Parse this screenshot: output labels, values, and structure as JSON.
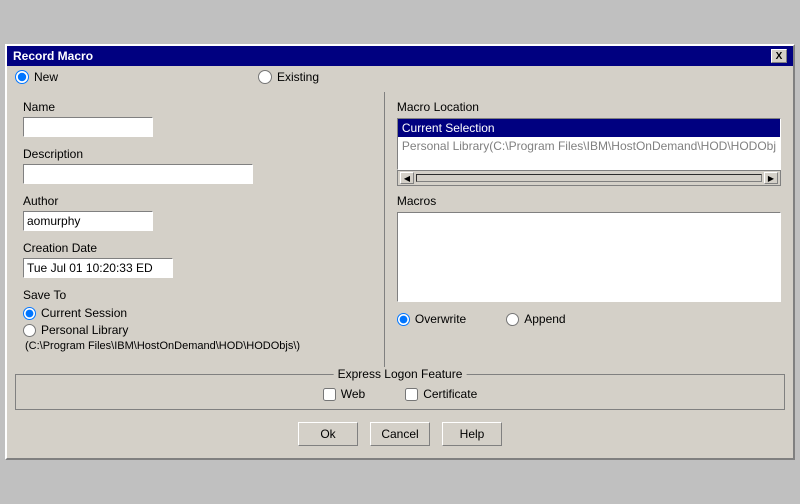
{
  "dialog": {
    "title": "Record Macro",
    "close_label": "X"
  },
  "top": {
    "new_label": "New",
    "existing_label": "Existing"
  },
  "left": {
    "name_label": "Name",
    "name_value": "",
    "name_placeholder": "",
    "description_label": "Description",
    "description_value": "",
    "description_placeholder": "",
    "author_label": "Author",
    "author_value": "aomurphy",
    "date_label": "Creation Date",
    "date_value": "Tue Jul 01 10:20:33 ED",
    "save_to_label": "Save To",
    "current_session_label": "Current Session",
    "personal_library_label": "Personal Library",
    "personal_library_path": "(C:\\Program Files\\IBM\\HostOnDemand\\HOD\\HODObjs\\)"
  },
  "right": {
    "macro_location_label": "Macro Location",
    "location_items": [
      {
        "text": "Current Selection",
        "selected": true
      },
      {
        "text": "Personal Library(C:\\Program Files\\IBM\\HostOnDemand\\HOD\\HODObj",
        "selected": false
      }
    ],
    "macros_label": "Macros",
    "overwrite_label": "Overwrite",
    "append_label": "Append"
  },
  "bottom": {
    "express_logon_title": "Express Logon Feature",
    "web_label": "Web",
    "certificate_label": "Certificate",
    "ok_label": "Ok",
    "cancel_label": "Cancel",
    "help_label": "Help"
  }
}
